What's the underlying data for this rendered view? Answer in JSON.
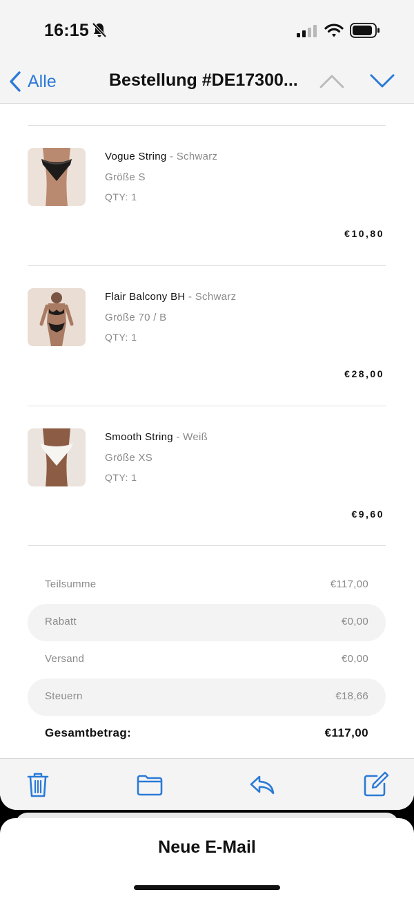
{
  "status_bar": {
    "time": "16:15"
  },
  "nav": {
    "back_label": "Alle",
    "title": "Bestellung #DE17300..."
  },
  "items": [
    {
      "name": "Vogue String",
      "variant": " - Schwarz",
      "size": "Größe S",
      "qty": "QTY: 1",
      "price": "€10,80"
    },
    {
      "name": "Flair Balcony BH",
      "variant": " - Schwarz",
      "size": "Größe 70 / B",
      "qty": "QTY: 1",
      "price": "€28,00"
    },
    {
      "name": "Smooth String",
      "variant": " - Weiß",
      "size": "Größe XS",
      "qty": "QTY: 1",
      "price": "€9,60"
    }
  ],
  "summary": {
    "subtotal_label": "Teilsumme",
    "subtotal_value": "€117,00",
    "discount_label": "Rabatt",
    "discount_value": "€0,00",
    "shipping_label": "Versand",
    "shipping_value": "€0,00",
    "tax_label": "Steuern",
    "tax_value": "€18,66",
    "total_label": "Gesamtbetrag:",
    "total_value": "€117,00"
  },
  "toolbar": {
    "icons": [
      "trash-icon",
      "folder-icon",
      "reply-icon",
      "compose-icon"
    ]
  },
  "compose": {
    "title": "Neue E-Mail"
  },
  "colors": {
    "accent": "#2b7ad6",
    "muted_text": "#8a8a8a",
    "row_shade": "#f3f3f3"
  }
}
